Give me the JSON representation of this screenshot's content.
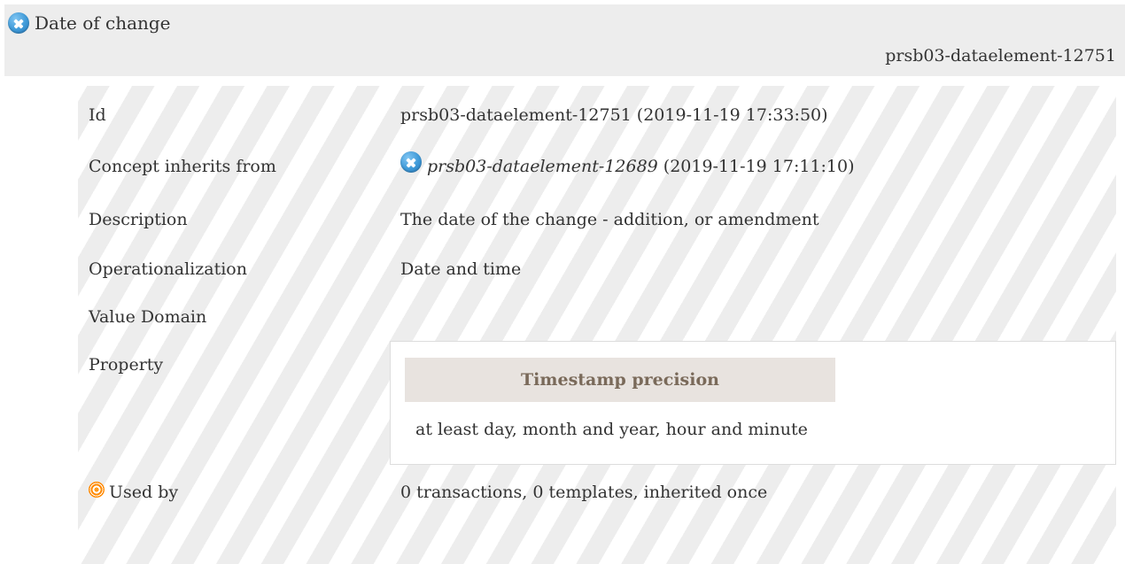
{
  "header": {
    "title": "Date of change",
    "id": "prsb03-dataelement-12751"
  },
  "rows": [
    {
      "label": "Id",
      "value": "prsb03-dataelement-12751 (2019-11-19 17:33:50)"
    },
    {
      "label": "Concept inherits from",
      "link": "prsb03-dataelement-12689",
      "value": "(2019-11-19 17:11:10)"
    },
    {
      "label": "Description",
      "value": "The date of the change - addition, or amendment"
    },
    {
      "label": "Operationalization",
      "value": "Date and time"
    },
    {
      "label": "Value Domain",
      "value": ""
    },
    {
      "label": "Property"
    },
    {
      "label": "Used by",
      "value": "0 transactions, 0 templates, inherited once"
    }
  ],
  "property": {
    "name": "Timestamp precision",
    "value": "at least day, month and year, hour and minute"
  },
  "icons": {
    "header": "close-circle-icon",
    "inherits": "close-circle-icon",
    "used_by": "target-icon"
  }
}
